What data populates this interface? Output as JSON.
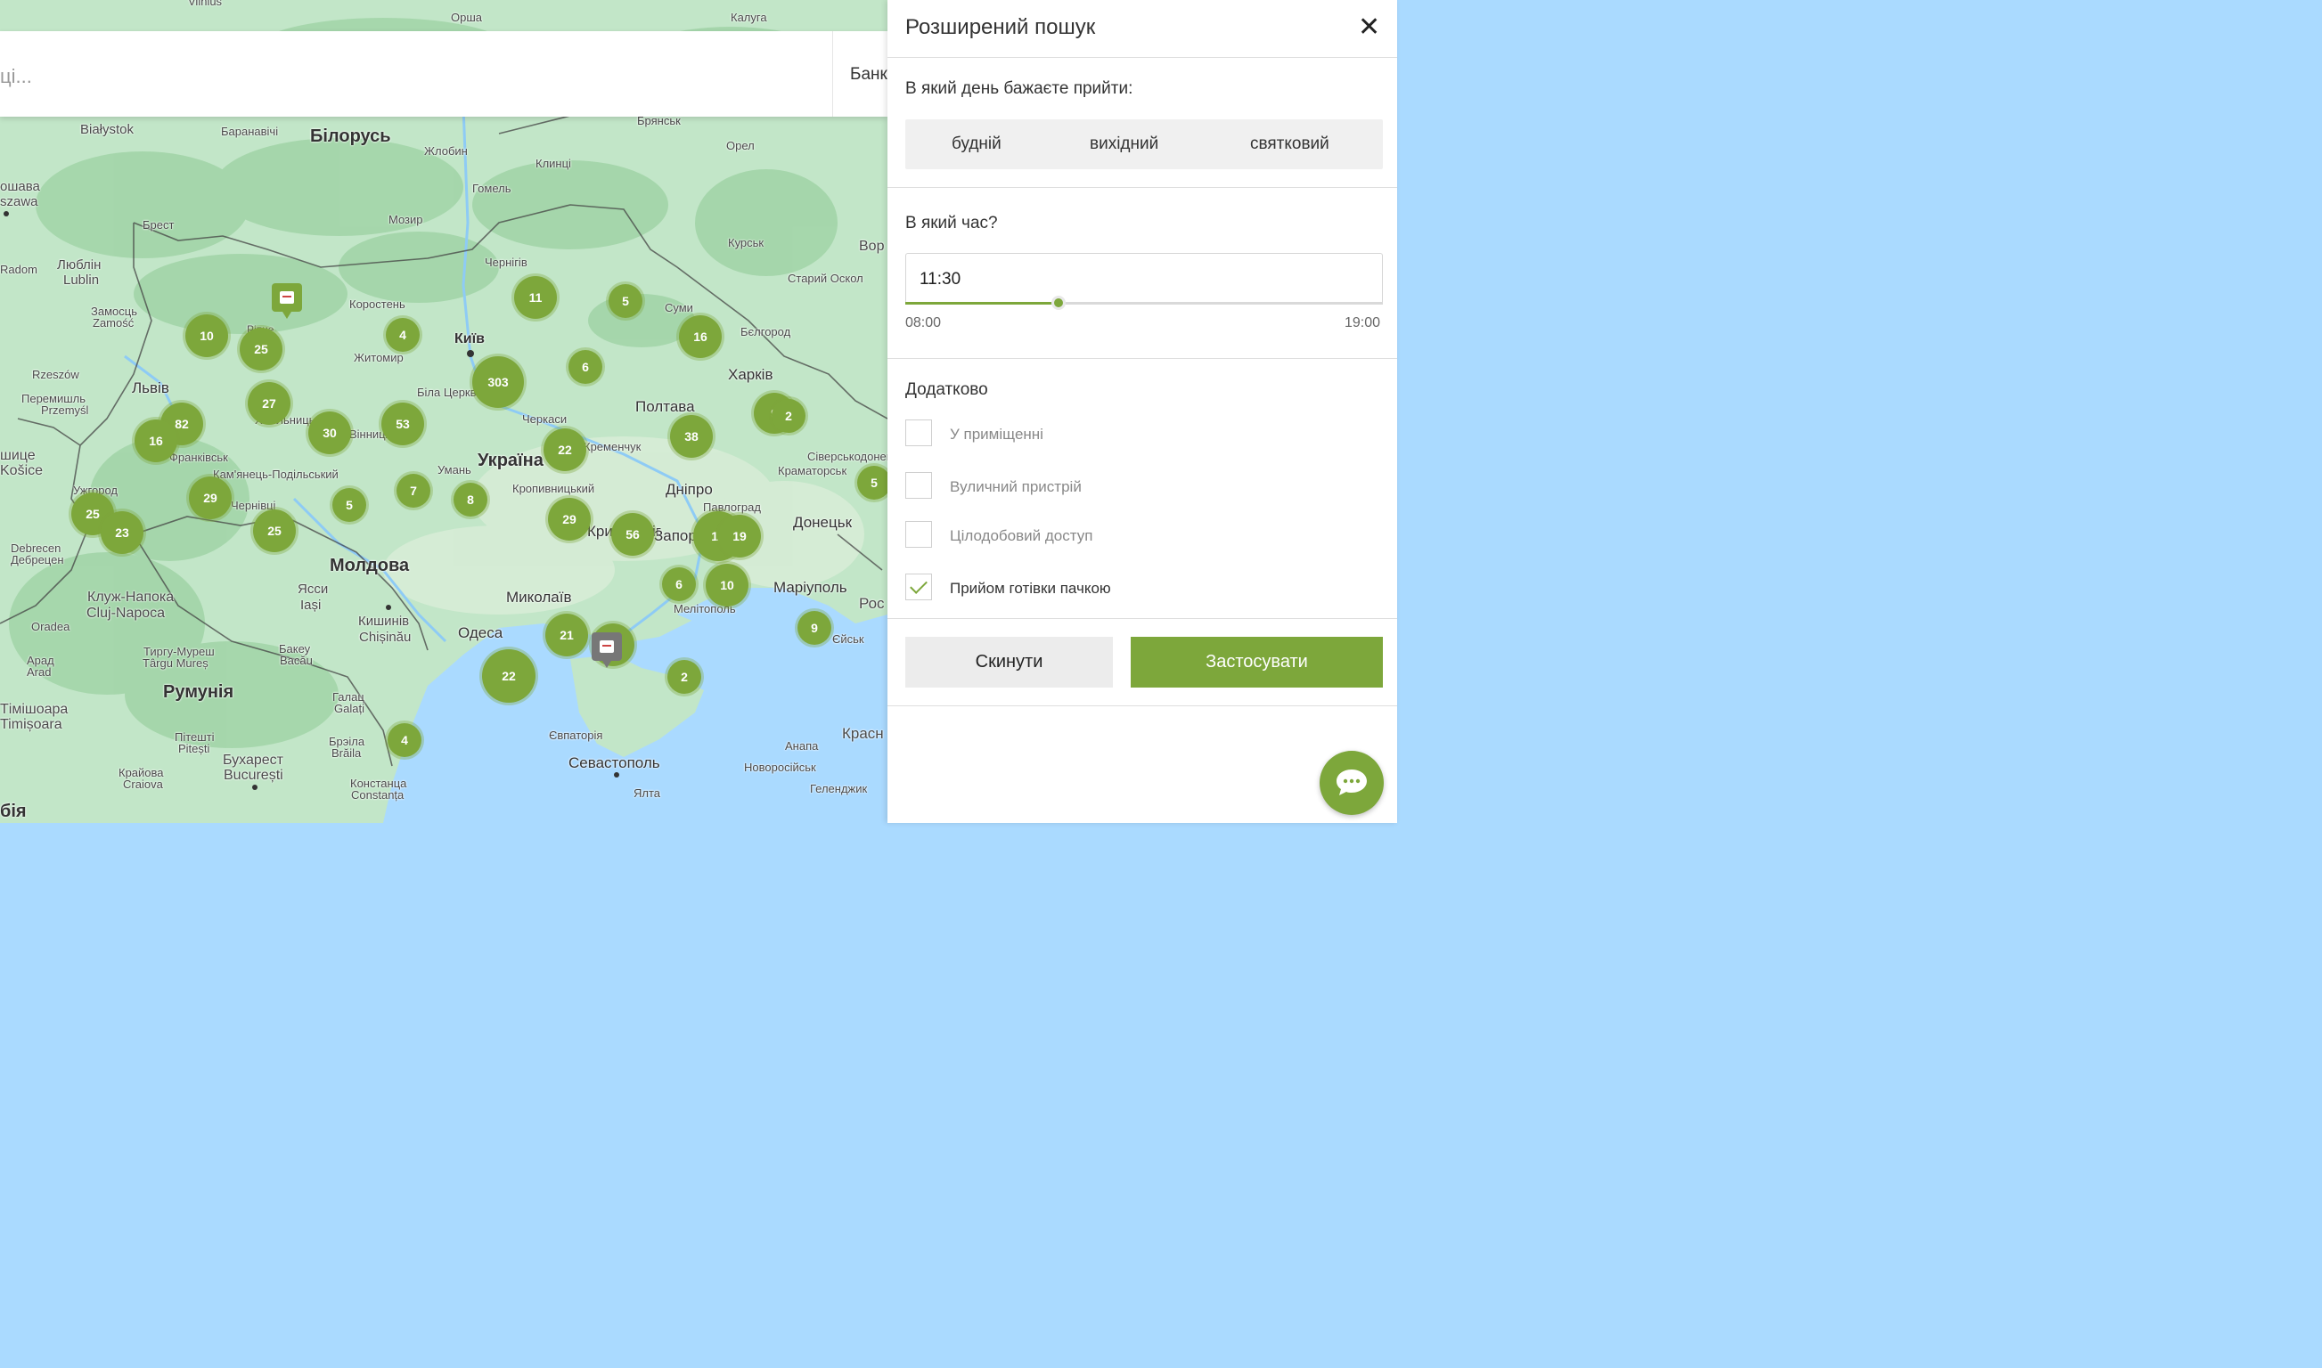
{
  "search": {
    "placeholder": "ці...",
    "right_text": "Банк"
  },
  "panel": {
    "title": "Розширений пошук",
    "day_question": "В який день бажаєте прийти:",
    "day_options": [
      "будній",
      "вихідний",
      "святковий"
    ],
    "time_question": "В який час?",
    "time_value": "11:30",
    "time_min": "08:00",
    "time_max": "19:00",
    "time_fraction": 0.32,
    "extra_title": "Додатково",
    "checkboxes": [
      {
        "label": "У приміщенні",
        "checked": false
      },
      {
        "label": "Вуличний пристрій",
        "checked": false
      },
      {
        "label": "Цілодобовий доступ",
        "checked": false
      },
      {
        "label": "Прийом готівки пачкою",
        "checked": true
      }
    ],
    "reset_label": "Скинути",
    "apply_label": "Застосувати"
  },
  "map": {
    "labels": [
      "Vilnius",
      "Орша",
      "Калуга",
      "Białystok",
      "Баранавічі",
      "Білорусь",
      "Брянськ",
      "Жлобин",
      "Орел",
      "Клинці",
      "Гомель",
      "szawa",
      "Брест",
      "Мозир",
      "Курськ",
      "Вор",
      "Люблін",
      "Lublin",
      "Чернігів",
      "Старий Оскол",
      "Radom",
      "Замосць",
      "Zamość",
      "Коростень",
      "Суми",
      "Київ",
      "Бєлгород",
      "Житомир",
      "Rzeszów",
      "Львів",
      "Харків",
      "Перемишль",
      "Przemyśl",
      "Біла Церква",
      "Полтава",
      "Черкаси",
      "Кременчук",
      "Вінниця",
      "Хмельницький",
      "Франківськ",
      "Кам'янець-Подільський",
      "Košice",
      "Ужгород",
      "Умань",
      "Україна",
      "Сіверськодонецьк",
      "Краматорськ",
      "Кропивницький",
      "Дніпро",
      "Павлоград",
      "Чернівці",
      "Донецьк",
      "Молдова",
      "Debrecen",
      "Дебрецен",
      "Кривий Ріг",
      "Запоріжжя",
      "Клуж-Напока",
      "Cluj-Napoca",
      "Ясси",
      "Iași",
      "Миколаїв",
      "Маріуполь",
      "Рос",
      "Мелітополь",
      "Кишинів",
      "Chișinău",
      "Oradea",
      "Одеса",
      "Єйськ",
      "Арад",
      "Arad",
      "Тиргу-Муреш",
      "Târgu Mureș",
      "Бакеу",
      "Bacău",
      "Румунія",
      "Галац",
      "Galați",
      "Тімішоара",
      "Timișoara",
      "Брэіла",
      "Brăila",
      "Євпаторія",
      "Пітешті",
      "Pitești",
      "Анапа",
      "Красн",
      "Севастополь",
      "Новоросійськ",
      "Бухарест",
      "București",
      "Крайова",
      "Craiova",
      "Констанца",
      "Constanța",
      "Ялта",
      "Геленджик",
      "бія",
      "шице",
      "ошава",
      "Ріпне"
    ],
    "clusters": [
      "11",
      "5",
      "10",
      "25",
      "4",
      "16",
      "303",
      "6",
      "82",
      "27",
      "16",
      "30",
      "53",
      "9",
      "2",
      "22",
      "38",
      "29",
      "5",
      "7",
      "8",
      "5",
      "25",
      "23",
      "25",
      "29",
      "56",
      "10",
      "19",
      "6",
      "10",
      "21",
      "9",
      "22",
      "2",
      "4",
      "3"
    ],
    "pin_icons": [
      "atm-pin-icon",
      "branch-pin-icon"
    ]
  },
  "colors": {
    "accent": "#7da73b",
    "land": "#bfe3c3",
    "forest": "#9fd3a4",
    "water": "#aadaff"
  }
}
